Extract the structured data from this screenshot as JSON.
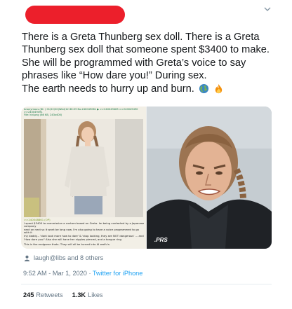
{
  "tweet": {
    "lines": [
      "There is a Greta Thunberg sex doll. There is a Greta",
      "Thunberg sex doll that someone spent $3400 to make.",
      "She will be programmed with Greta’s voice to say",
      "phrases like “How dare you!” During sex.",
      "The earth needs to hurry up and burn."
    ],
    "emoji": [
      "globe-emoji",
      "fire-emoji"
    ]
  },
  "media": {
    "board_header": "Anonymous (ID: ) 01/22/20(Wed)12:36:59 No.240049061 ▶ >>240049483 >>240049490 >>240049491",
    "board_file": "File: kid.png (86 KB, 243x400)",
    "board_post_lines": [
      ">>240048861 (OP)",
      "I spent $3400 to commission a custom based on Greta. Im being contacted by a Japanese company",
      "next on next so it wont be long now. I'm also going to have a voice programmed to go with it",
      "my daddy... 'dont look more how to dare' & 'stop looking, they are NOT dangerous' ... and",
      "'How dare you!' Also she will have her nipples pierced, and a tongue ring.",
      "This is the endgame thots. They will all be turned into AI waifu's."
    ],
    "watermark": ".PRS"
  },
  "liked_by": "laugh@libs and 8 others",
  "timestamp": "9:52 AM - Mar 1, 2020 · ",
  "source": "Twitter for iPhone",
  "stats": {
    "retweets_count": "245",
    "retweets_label": "Retweets",
    "likes_count": "1.3K",
    "likes_label": "Likes"
  },
  "colors": {
    "redaction": "#ec1f2b",
    "link": "#1da1f2",
    "muted": "#657786"
  }
}
